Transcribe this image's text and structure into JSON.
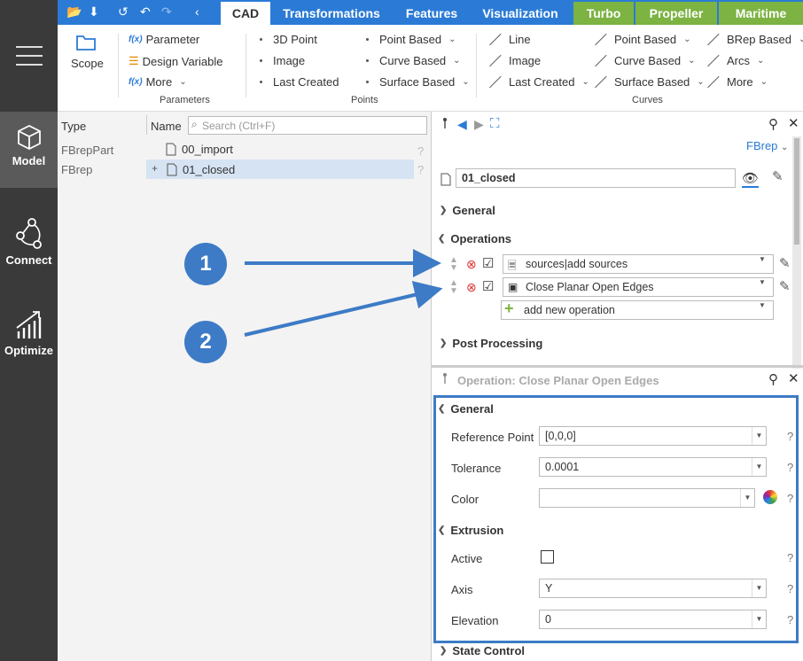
{
  "sidebar": {
    "items": [
      {
        "label": "Model",
        "icon": "cube-icon"
      },
      {
        "label": "Connect",
        "icon": "connect-icon"
      },
      {
        "label": "Optimize",
        "icon": "chart-icon"
      }
    ]
  },
  "tabs": [
    {
      "label": "CAD"
    },
    {
      "label": "Transformations"
    },
    {
      "label": "Features"
    },
    {
      "label": "Visualization"
    },
    {
      "label": "Turbo"
    },
    {
      "label": "Propeller"
    },
    {
      "label": "Maritime"
    }
  ],
  "ribbon": {
    "scope": "Scope",
    "parameters": {
      "items": [
        "Parameter",
        "Design Variable",
        "More"
      ],
      "group": "Parameters"
    },
    "points": {
      "col1": [
        "3D Point",
        "Image",
        "Last Created"
      ],
      "col2": [
        "Point Based",
        "Curve Based",
        "Surface Based"
      ],
      "group": "Points"
    },
    "curves": {
      "col1": [
        "Line",
        "Image",
        "Last Created"
      ],
      "col2": [
        "Point Based",
        "Curve Based",
        "Surface Based"
      ],
      "col3": [
        "BRep Based",
        "Arcs",
        "More"
      ],
      "group": "Curves"
    }
  },
  "tree": {
    "col_type": "Type",
    "col_name": "Name",
    "search_placeholder": "Search (Ctrl+F)",
    "rows": [
      {
        "type": "FBrepPart",
        "name": "00_import",
        "q": "?"
      },
      {
        "type": "FBrep",
        "name": "01_closed",
        "q": "?",
        "expand": "+"
      }
    ]
  },
  "callouts": {
    "one": "1",
    "two": "2"
  },
  "props": {
    "type_label": "FBrep",
    "name": "01_closed",
    "general": "General",
    "operations": "Operations",
    "ops": [
      "sources|add sources",
      "Close Planar Open Edges"
    ],
    "add_op": "add new operation",
    "post": "Post Processing"
  },
  "opPanel": {
    "title": "Operation: Close Planar Open Edges",
    "general": "General",
    "ref_label": "Reference Point",
    "ref_value": "[0,0,0]",
    "tol_label": "Tolerance",
    "tol_value": "0.0001",
    "color_label": "Color",
    "color_value": "",
    "extrusion": "Extrusion",
    "active_label": "Active",
    "axis_label": "Axis",
    "axis_value": "Y",
    "elev_label": "Elevation",
    "elev_value": "0",
    "state": "State Control",
    "q": "?"
  },
  "colors": {
    "blue": "#2b7bd6",
    "green": "#7cb342",
    "sidebar": "#3a3a3a",
    "callout": "#3d7bc6"
  }
}
